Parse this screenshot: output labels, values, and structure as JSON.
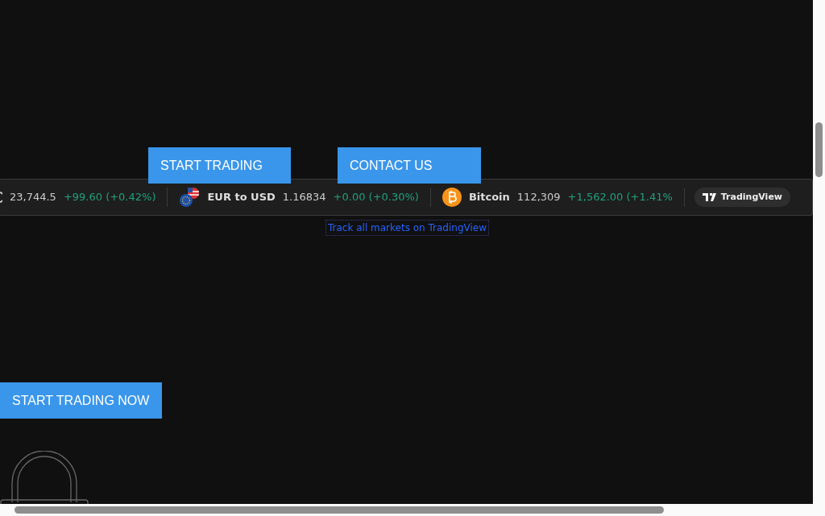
{
  "hero_buttons": [
    "START TRADING",
    "CONTACT US"
  ],
  "ticker": {
    "items": [
      {
        "kind": "partial",
        "price": "23,744.5",
        "change": "+99.60 (+0.42%)"
      },
      {
        "kind": "flags",
        "name": "EUR to USD",
        "price": "1.16834",
        "change": "+0.00 (+0.30%)"
      },
      {
        "kind": "bitcoin",
        "name": "Bitcoin",
        "price": "112,309",
        "change": "+1,562.00 (+1.41%"
      }
    ],
    "brand": "TradingView"
  },
  "ticker_link": "Track all markets on TradingView",
  "cta_button": "START TRADING NOW"
}
